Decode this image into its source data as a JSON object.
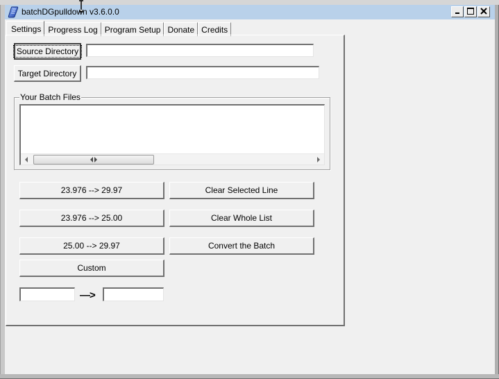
{
  "window": {
    "title": "batchDGpulldown v3.6.0.0",
    "controls": {
      "minimize": "minimize",
      "maximize": "maximize",
      "close": "close"
    }
  },
  "tabs": [
    {
      "label": "Settings",
      "active": true
    },
    {
      "label": "Progress Log",
      "active": false
    },
    {
      "label": "Program Setup",
      "active": false
    },
    {
      "label": "Donate",
      "active": false
    },
    {
      "label": "Credits",
      "active": false
    }
  ],
  "settings": {
    "source_directory": {
      "button_label": "Source Directory",
      "value": ""
    },
    "target_directory": {
      "button_label": "Target Directory",
      "value": ""
    },
    "batch_files": {
      "group_label": "Your Batch Files",
      "items": []
    },
    "conversion_buttons": [
      {
        "label": "23.976 --> 29.97"
      },
      {
        "label": "23.976 --> 25.00"
      },
      {
        "label": "25.00 --> 29.97"
      },
      {
        "label": "Custom"
      }
    ],
    "action_buttons": [
      {
        "label": "Clear Selected Line"
      },
      {
        "label": "Clear Whole List"
      },
      {
        "label": "Convert the Batch"
      }
    ],
    "custom_rate": {
      "from_value": "",
      "arrow": "—>",
      "to_value": ""
    }
  }
}
